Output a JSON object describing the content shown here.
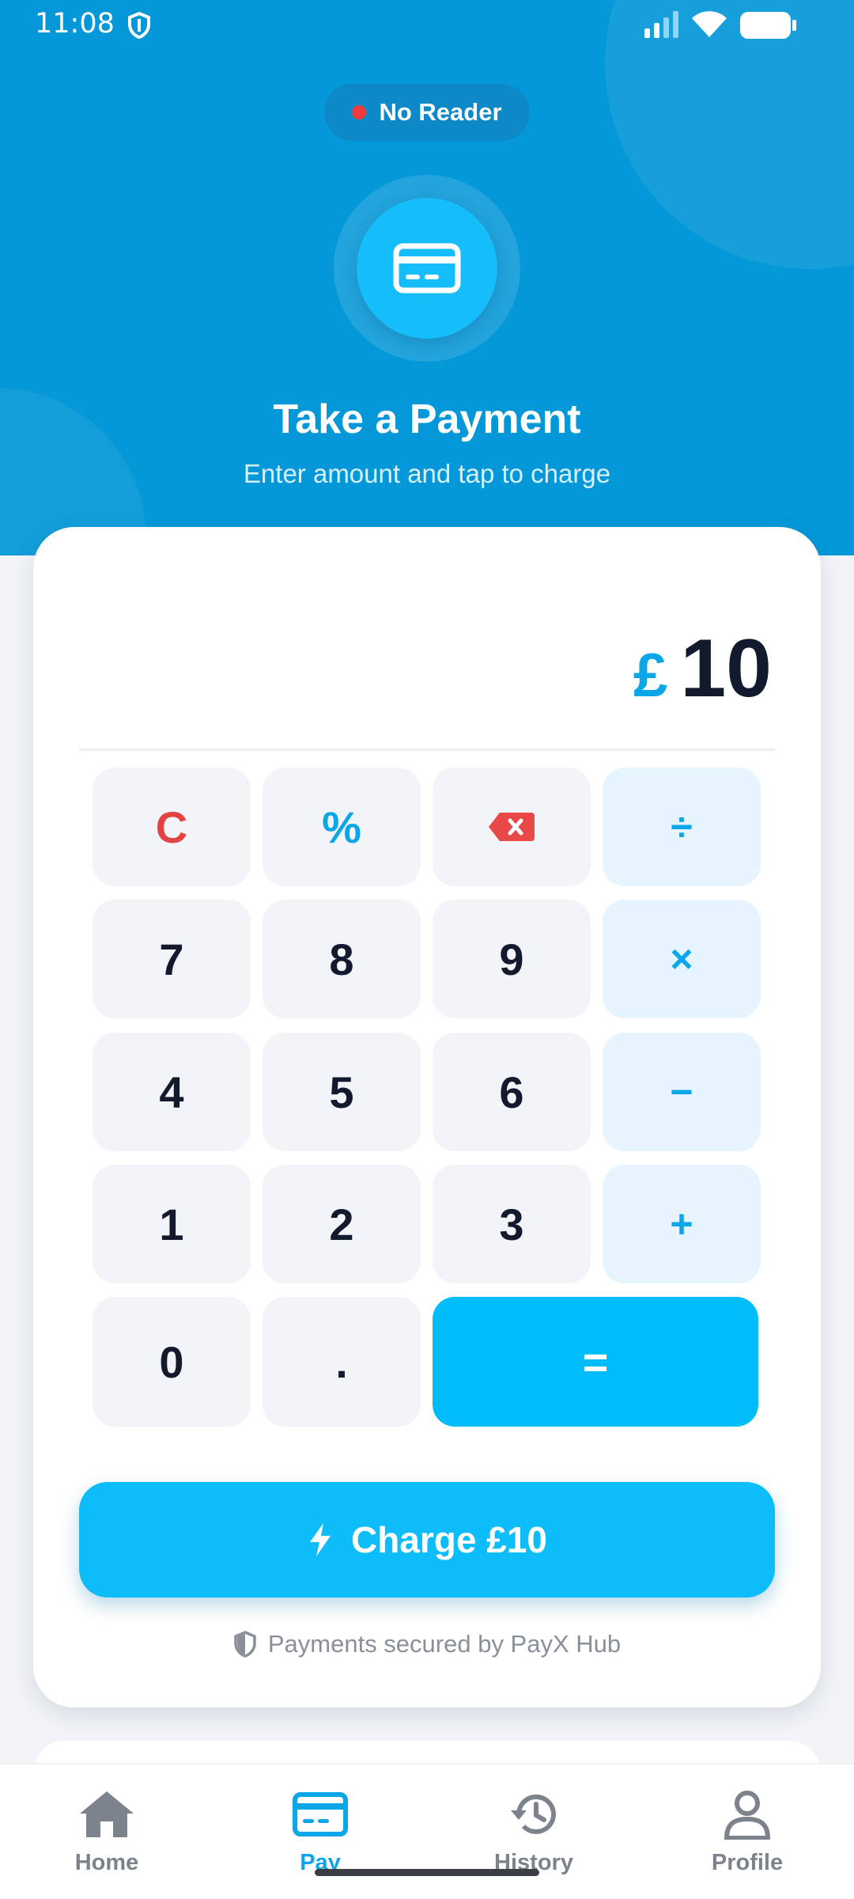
{
  "status_bar": {
    "time": "11:08"
  },
  "reader": {
    "status": "No Reader"
  },
  "header": {
    "title": "Take a Payment",
    "subtitle": "Enter amount and tap to charge"
  },
  "amount": {
    "currency": "£",
    "value": "10"
  },
  "keypad": {
    "clear": "C",
    "percent": "%",
    "divide": "÷",
    "multiply": "×",
    "minus": "−",
    "plus": "+",
    "equals": "=",
    "dot": ".",
    "digits": [
      "0",
      "1",
      "2",
      "3",
      "4",
      "5",
      "6",
      "7",
      "8",
      "9"
    ]
  },
  "charge": {
    "label": "Charge £10"
  },
  "security": {
    "note": "Payments secured by PayX Hub"
  },
  "nav": {
    "items": [
      {
        "label": "Home",
        "icon": "home-icon"
      },
      {
        "label": "Pay",
        "icon": "card-icon"
      },
      {
        "label": "History",
        "icon": "history-icon"
      },
      {
        "label": "Profile",
        "icon": "profile-icon"
      }
    ],
    "active": "Pay"
  },
  "colors": {
    "brand": "#0598d8",
    "accent": "#00bdf9",
    "danger": "#e34343"
  }
}
